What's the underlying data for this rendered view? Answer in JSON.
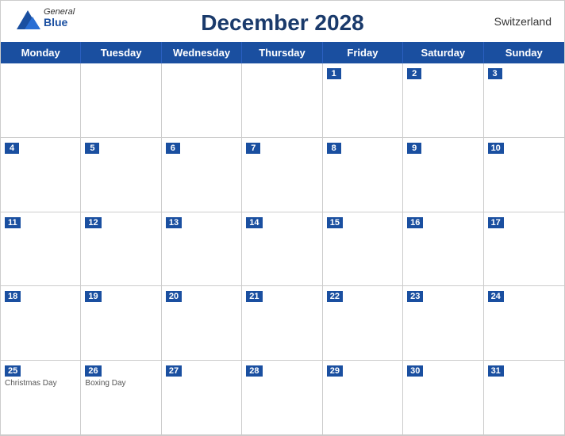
{
  "header": {
    "title": "December 2028",
    "country": "Switzerland",
    "logo": {
      "general": "General",
      "blue": "Blue"
    }
  },
  "days": [
    "Monday",
    "Tuesday",
    "Wednesday",
    "Thursday",
    "Friday",
    "Saturday",
    "Sunday"
  ],
  "weeks": [
    [
      {
        "date": "",
        "empty": true
      },
      {
        "date": "",
        "empty": true
      },
      {
        "date": "",
        "empty": true
      },
      {
        "date": "",
        "empty": true
      },
      {
        "date": "1"
      },
      {
        "date": "2"
      },
      {
        "date": "3"
      }
    ],
    [
      {
        "date": "4"
      },
      {
        "date": "5"
      },
      {
        "date": "6"
      },
      {
        "date": "7"
      },
      {
        "date": "8"
      },
      {
        "date": "9"
      },
      {
        "date": "10"
      }
    ],
    [
      {
        "date": "11"
      },
      {
        "date": "12"
      },
      {
        "date": "13"
      },
      {
        "date": "14"
      },
      {
        "date": "15"
      },
      {
        "date": "16"
      },
      {
        "date": "17"
      }
    ],
    [
      {
        "date": "18"
      },
      {
        "date": "19"
      },
      {
        "date": "20"
      },
      {
        "date": "21"
      },
      {
        "date": "22"
      },
      {
        "date": "23"
      },
      {
        "date": "24"
      }
    ],
    [
      {
        "date": "25",
        "holiday": "Christmas Day"
      },
      {
        "date": "26",
        "holiday": "Boxing Day"
      },
      {
        "date": "27"
      },
      {
        "date": "28"
      },
      {
        "date": "29"
      },
      {
        "date": "30"
      },
      {
        "date": "31"
      }
    ]
  ]
}
